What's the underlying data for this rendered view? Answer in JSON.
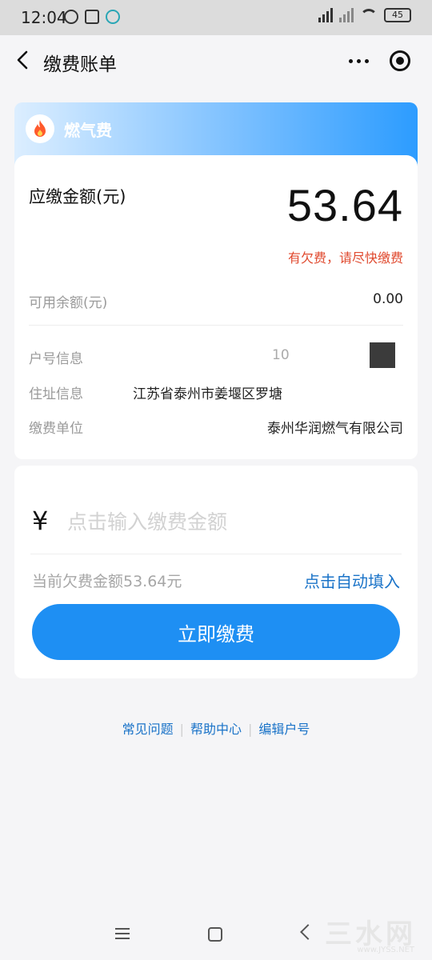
{
  "status_bar": {
    "time": "12:04",
    "battery": "45"
  },
  "nav": {
    "title": "缴费账单"
  },
  "header": {
    "title": "燃气费"
  },
  "bill": {
    "due_label": "应缴金额(元)",
    "due_amount": "53.64",
    "arrears_note": "有欠费，请尽快缴费",
    "balance_label": "可用余额(元)",
    "balance_value": "0.00",
    "account_label": "户号信息",
    "account_value": "10",
    "address_label": "住址信息",
    "address_value": "江苏省泰州市姜堰区罗塘",
    "company_label": "缴费单位",
    "company_value": "泰州华润燃气有限公司"
  },
  "payment": {
    "currency_symbol": "¥",
    "input_placeholder": "点击输入缴费金额",
    "current_arrears": "当前欠费金额53.64元",
    "autofill_label": "点击自动填入",
    "pay_button_label": "立即缴费"
  },
  "footer": {
    "links": [
      "常见问题",
      "帮助中心",
      "编辑户号"
    ]
  },
  "watermark": {
    "text": "三水网",
    "sub": "www.JYSS.NET"
  },
  "colors": {
    "accent": "#1e8ff3",
    "link": "#1a73c8",
    "warning": "#e04a2f"
  }
}
